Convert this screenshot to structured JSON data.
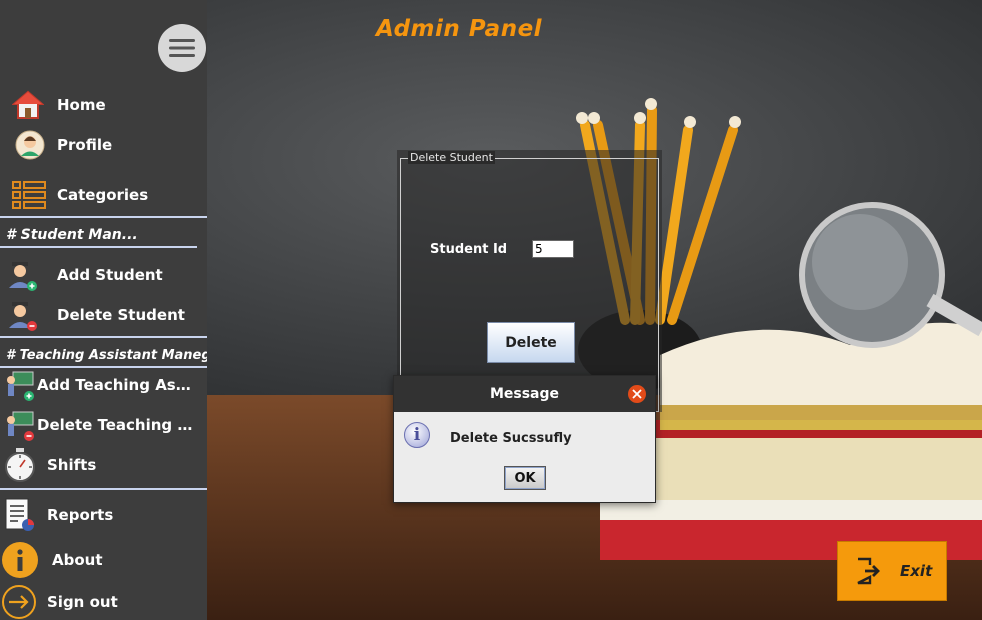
{
  "header": {
    "title": "Admin Panel"
  },
  "sidebar": {
    "items": [
      {
        "label": "Home",
        "icon": "home-icon"
      },
      {
        "label": "Profile",
        "icon": "profile-icon"
      },
      {
        "label": "Categories",
        "icon": "categories-icon"
      },
      {
        "label": "Add Student",
        "icon": "add-student-icon"
      },
      {
        "label": "Delete Student",
        "icon": "delete-student-icon"
      },
      {
        "label": "Add Teaching Ass...",
        "icon": "add-ta-icon"
      },
      {
        "label": "Delete Teaching A...",
        "icon": "delete-ta-icon"
      },
      {
        "label": "Shifts",
        "icon": "stopwatch-icon"
      },
      {
        "label": "Reports",
        "icon": "report-icon"
      },
      {
        "label": "About",
        "icon": "info-icon"
      },
      {
        "label": "Sign out",
        "icon": "sign-out-icon"
      }
    ],
    "sections": {
      "student": "# Student Man...",
      "ta": "# Teaching Assistant Manegment"
    }
  },
  "panel": {
    "legend": "Delete Student",
    "student_id_label": "Student Id",
    "student_id_value": "5",
    "delete_label": "Delete"
  },
  "dialog": {
    "title": "Message",
    "message": "Delete Sucssufly",
    "ok_label": "OK"
  },
  "exit": {
    "label": "Exit"
  },
  "colors": {
    "accent": "#f5950f",
    "sidebar": "#3d3d3d",
    "separator": "#c9d4ee"
  }
}
